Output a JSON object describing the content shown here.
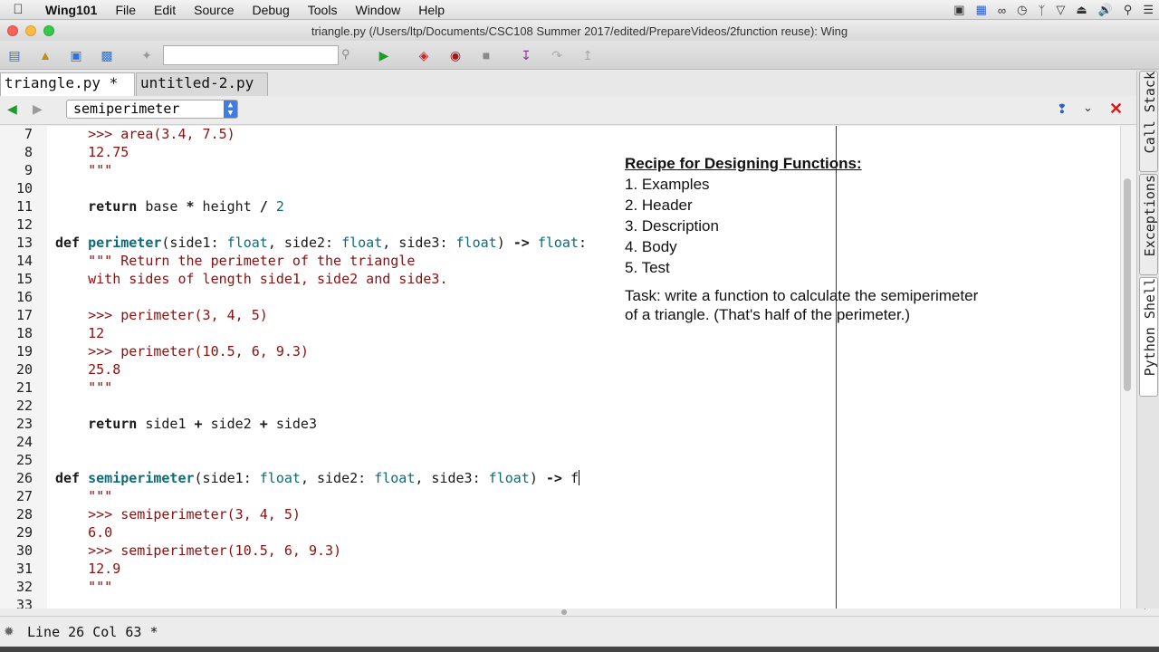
{
  "menubar": {
    "app": "Wing101",
    "items": [
      "File",
      "Edit",
      "Source",
      "Debug",
      "Tools",
      "Window",
      "Help"
    ],
    "tray_icons": [
      "video-camera-icon",
      "display-icon",
      "glasses-icon",
      "time-machine-icon",
      "bluetooth-icon",
      "wifi-icon",
      "eject-icon",
      "volume-icon",
      "search-icon",
      "list-icon"
    ]
  },
  "window": {
    "title": "triangle.py (/Users/ltp/Documents/CSC108 Summer 2017/edited/PrepareVideos/2function reuse): Wing"
  },
  "toolbar": {
    "search_value": "",
    "icons": [
      "new-file-icon",
      "open-folder-icon",
      "save-icon",
      "save-all-icon",
      "magic-icon",
      "run-icon",
      "debug-file-icon",
      "bug-icon",
      "stop-icon",
      "step-into-icon",
      "step-over-icon",
      "step-out-icon"
    ]
  },
  "tabs": [
    {
      "label": "triangle.py *",
      "active": true
    },
    {
      "label": "untitled-2.py",
      "active": false
    }
  ],
  "nav": {
    "selected_symbol": "semiperimeter"
  },
  "editor": {
    "line_numbers": [
      "7",
      "8",
      "9",
      "10",
      "11",
      "12",
      "13",
      "14",
      "15",
      "16",
      "17",
      "18",
      "19",
      "20",
      "21",
      "22",
      "23",
      "24",
      "25",
      "26",
      "27",
      "28",
      "29",
      "30",
      "31",
      "32",
      "33"
    ]
  },
  "recipe": {
    "title": "Recipe for Designing Functions:",
    "steps": [
      "1. Examples",
      "2. Header",
      "3. Description",
      "4. Body",
      "5. Test"
    ],
    "task_line1": "Task: write a function to calculate the semiperimeter",
    "task_line2": "of a triangle.  (That's half of the perimeter.)"
  },
  "sidebar_tabs": [
    "Call Stack",
    "Exceptions",
    "Python Shell"
  ],
  "status": {
    "text": "Line 26 Col 63 *"
  },
  "colors": {
    "keyword": "#1a1a1a",
    "function_name": "#0d6b7a",
    "string": "#8b0f0f",
    "edge_line": "#8b1a1a"
  }
}
